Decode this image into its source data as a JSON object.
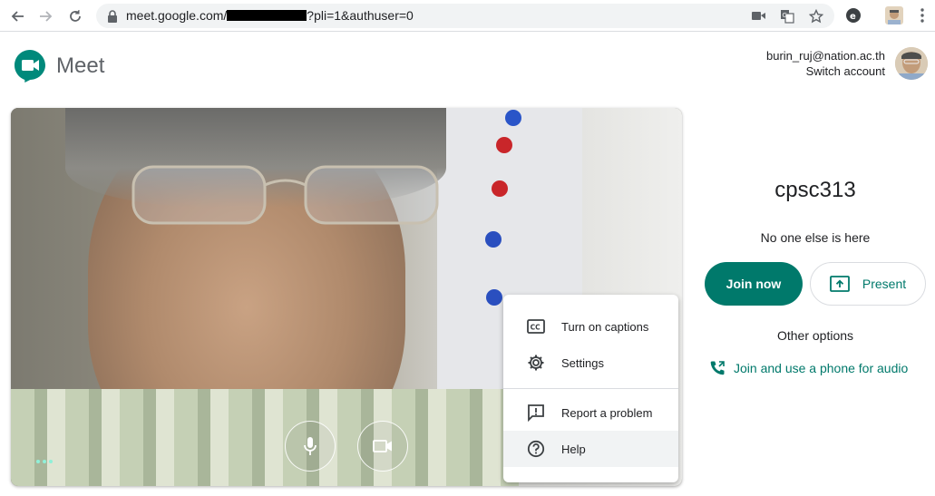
{
  "browser": {
    "url_prefix": "meet.google.com/",
    "url_suffix": "?pli=1&authuser=0"
  },
  "header": {
    "brand": "Meet",
    "account_email": "burin_ruj@nation.ac.th",
    "switch_account": "Switch account"
  },
  "menu": {
    "items": [
      {
        "label": "Turn on captions",
        "icon": "closed-captions-icon"
      },
      {
        "label": "Settings",
        "icon": "gear-icon"
      },
      {
        "label": "Report a problem",
        "icon": "feedback-icon"
      },
      {
        "label": "Help",
        "icon": "help-icon"
      }
    ]
  },
  "meeting": {
    "name": "cpsc313",
    "status": "No one else is here",
    "join_label": "Join now",
    "present_label": "Present",
    "other_options": "Other options",
    "phone_label": "Join and use a phone for audio"
  },
  "colors": {
    "accent": "#00796b",
    "text": "#202124"
  }
}
